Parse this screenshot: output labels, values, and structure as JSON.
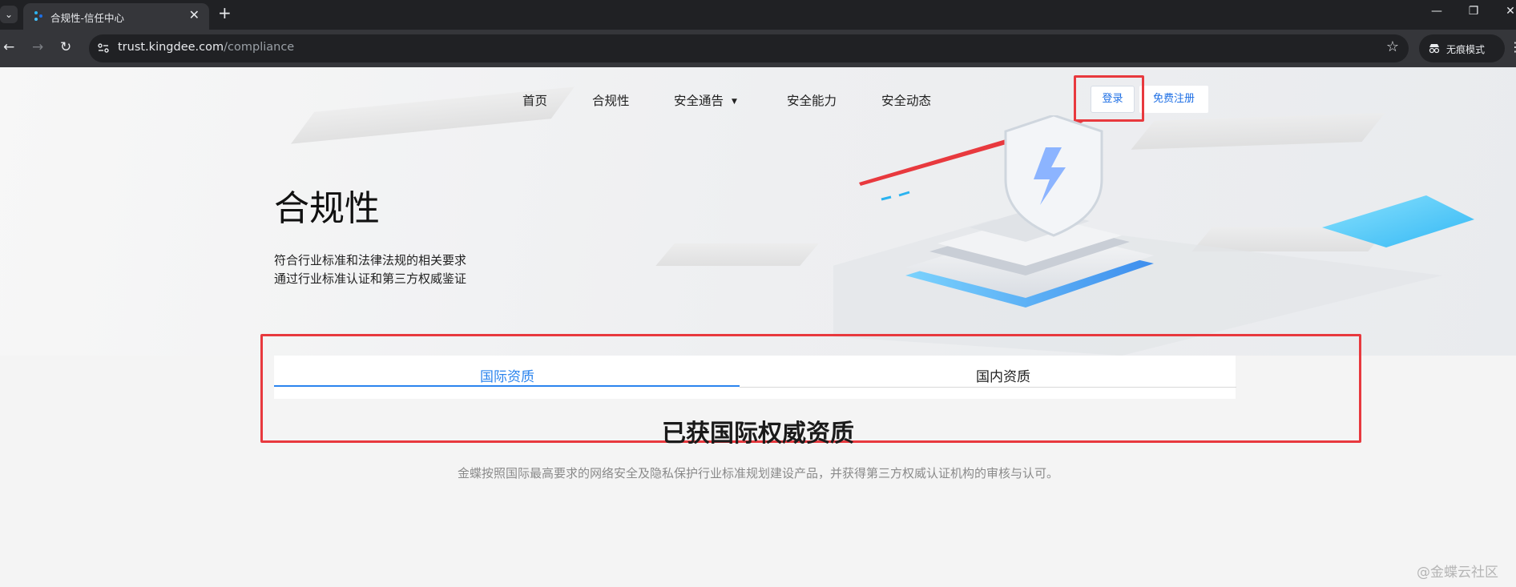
{
  "browser": {
    "tab_title": "合规性-信任中心",
    "new_tab": "+",
    "close_tab": "✕",
    "url_domain": "trust.kingdee.com",
    "url_path": "/compliance",
    "incognito_label": "无痕模式"
  },
  "header": {
    "nav": [
      {
        "label": "首页"
      },
      {
        "label": "合规性"
      },
      {
        "label": "安全通告"
      },
      {
        "label": "安全能力"
      },
      {
        "label": "安全动态"
      }
    ],
    "login": "登录",
    "register": "免费注册"
  },
  "hero": {
    "title": "合规性",
    "subtitle_line1": "符合行业标准和法律法规的相关要求",
    "subtitle_line2": "通过行业标准认证和第三方权威鉴证"
  },
  "tabs": {
    "international": "国际资质",
    "domestic": "国内资质",
    "active": "国际资质"
  },
  "section": {
    "title": "已获国际权威资质",
    "desc": "金蝶按照国际最高要求的网络安全及隐私保护行业标准规划建设产品，并获得第三方权威认证机构的审核与认可。"
  },
  "watermark": "@金蝶云社区",
  "colors": {
    "accent": "#2b84ee",
    "highlight": "#e8393e"
  }
}
